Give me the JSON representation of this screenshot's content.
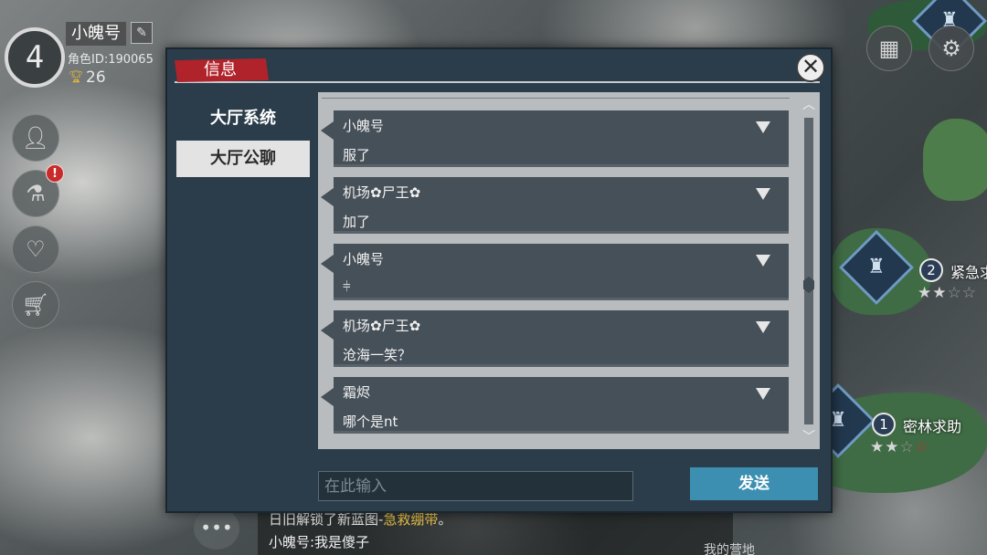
{
  "player": {
    "level": "4",
    "name": "小魄号",
    "role_id": "角色ID:190065",
    "trophies": "26",
    "alert": "!"
  },
  "map": {
    "locations": [
      {
        "number": "2",
        "name": "紧急求"
      },
      {
        "number": "1",
        "name": "密林求助"
      }
    ],
    "bottom_label": "我的营地"
  },
  "icons": {
    "edit": "pencil-icon",
    "trophy": "trophy-icon",
    "profile": "person-icon",
    "research": "flask-icon",
    "alliance": "handshake-icon",
    "shop": "cart-icon",
    "calendar": "calendar-icon",
    "settings": "gear-icon",
    "chat": "chat-bubble-icon",
    "close": "close-icon"
  },
  "dialog": {
    "title": "信息",
    "tabs": [
      "大厅系统",
      "大厅公聊"
    ],
    "selected_tab": "大厅公聊",
    "messages": [
      {
        "author": "小魄号",
        "text": "服了"
      },
      {
        "author": "机场✿尸王✿",
        "text": "加了"
      },
      {
        "author": "小魄号",
        "text": "⫩"
      },
      {
        "author": "机场✿尸王✿",
        "text": "沧海一笑？"
      },
      {
        "author": "霜烬",
        "text": "哪个是nt"
      }
    ],
    "input_placeholder": "在此输入",
    "send_label": "发送"
  },
  "ticker": {
    "line1_prefix": "日旧解锁了新蓝图-",
    "line1_highlight": "急救绷带",
    "line1_suffix": "。",
    "line2": "小魄号:我是傻子"
  },
  "colors": {
    "dialog_bg": "#2b3d4b",
    "title_red": "#b0232b",
    "send_blue": "#3c8fb0",
    "message_bg": "#465058"
  }
}
